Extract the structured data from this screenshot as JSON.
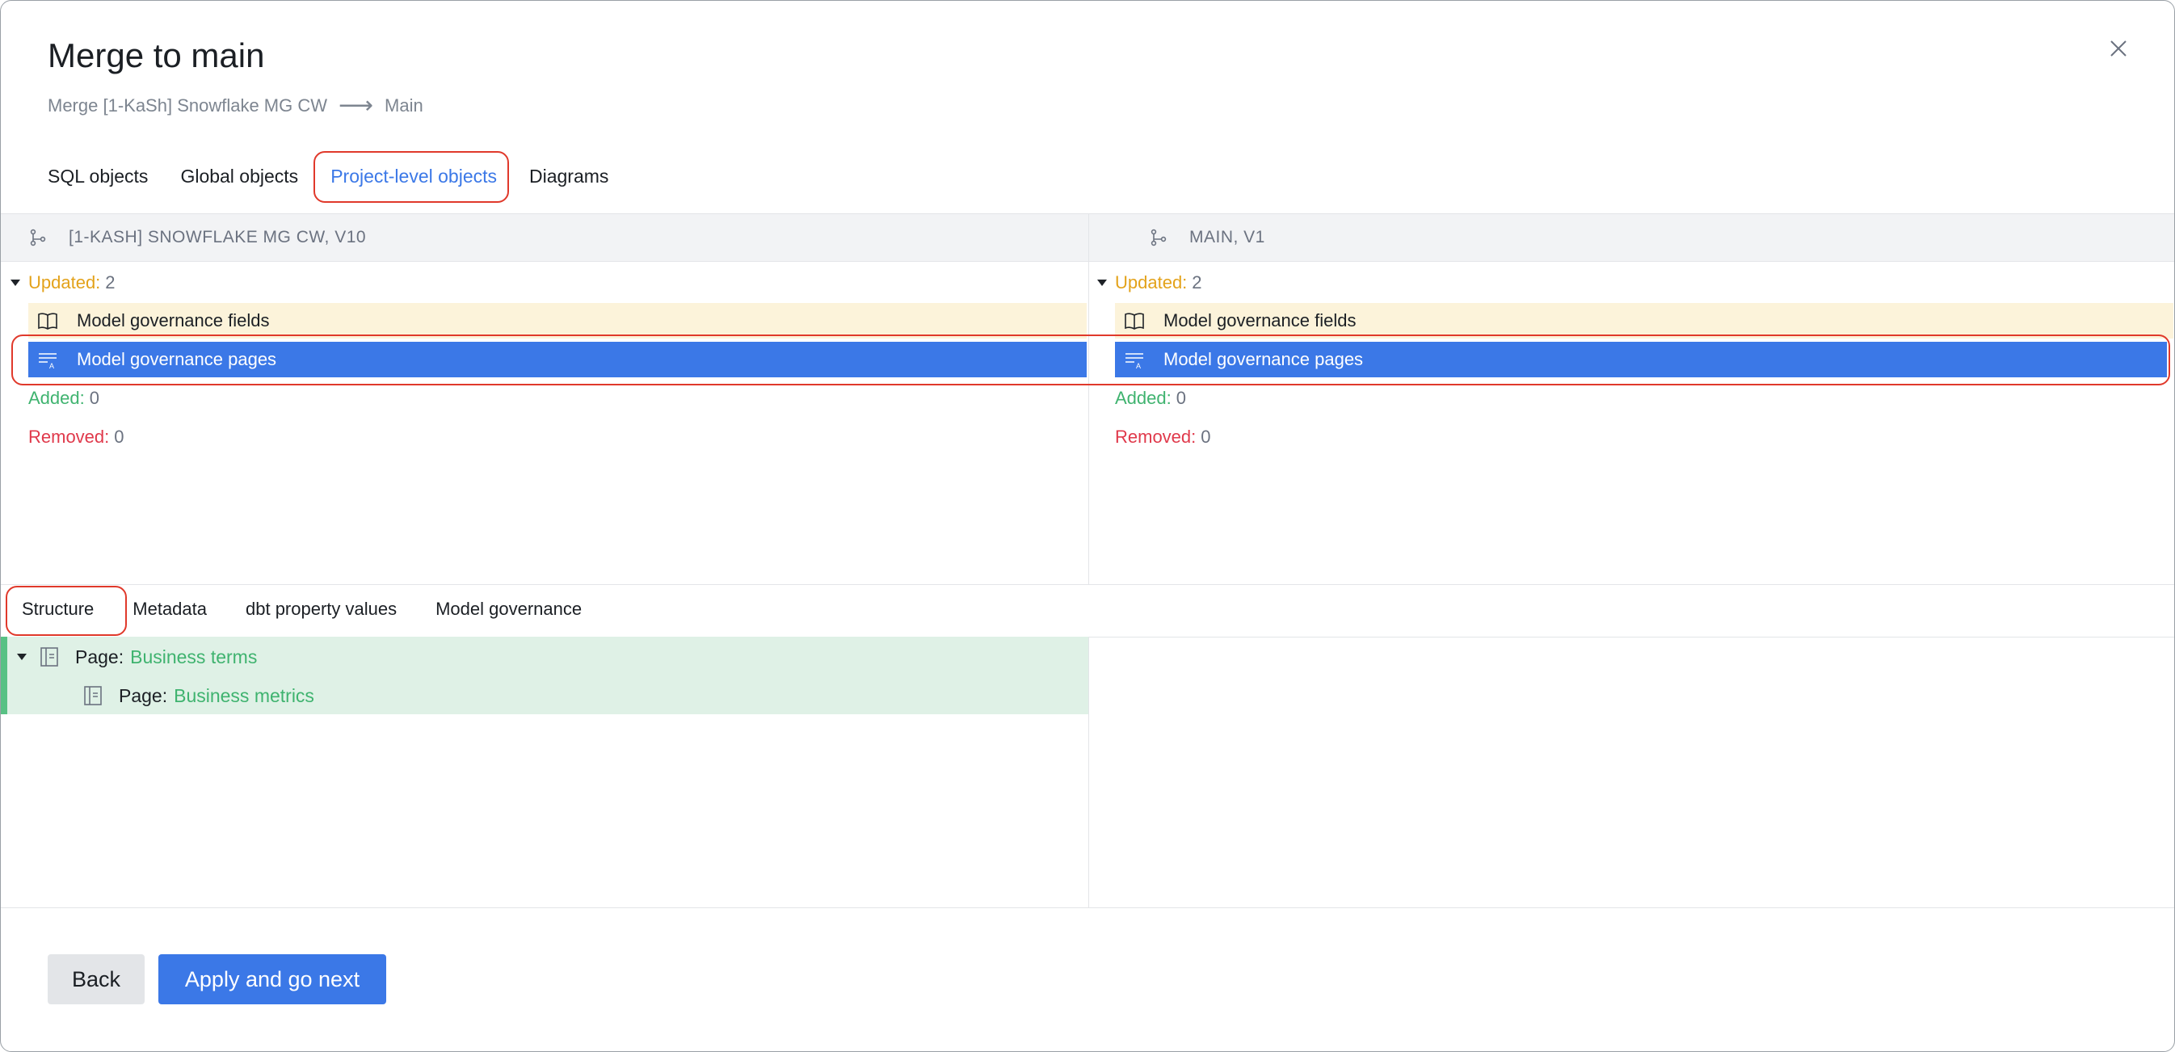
{
  "dialog": {
    "title": "Merge to main",
    "source": "Merge [1-KaSh] Snowflake MG CW",
    "arrow": "⟶",
    "target": "Main"
  },
  "tabs": [
    "SQL objects",
    "Global objects",
    "Project-level objects",
    "Diagrams"
  ],
  "left_pane": {
    "header": "[1-KASH] SNOWFLAKE MG CW, V10",
    "updated_label": "Updated:",
    "updated_count": "2",
    "items": [
      "Model governance fields",
      "Model governance pages"
    ],
    "added_label": "Added:",
    "added_count": "0",
    "removed_label": "Removed:",
    "removed_count": "0"
  },
  "right_pane": {
    "header": "MAIN, V1",
    "updated_label": "Updated:",
    "updated_count": "2",
    "items": [
      "Model governance fields",
      "Model governance pages"
    ],
    "added_label": "Added:",
    "added_count": "0",
    "removed_label": "Removed:",
    "removed_count": "0"
  },
  "detail_tabs": [
    "Structure",
    "Metadata",
    "dbt property values",
    "Model governance"
  ],
  "structure": [
    {
      "prefix": "Page:",
      "name": "Business terms"
    },
    {
      "prefix": "Page:",
      "name": "Business metrics"
    }
  ],
  "buttons": {
    "back": "Back",
    "apply": "Apply and go next"
  },
  "colors": {
    "accent": "#3b78e7",
    "updated": "#e3a21a",
    "added": "#3fb36f",
    "removed": "#e0394b",
    "highlight": "#e0392b"
  }
}
